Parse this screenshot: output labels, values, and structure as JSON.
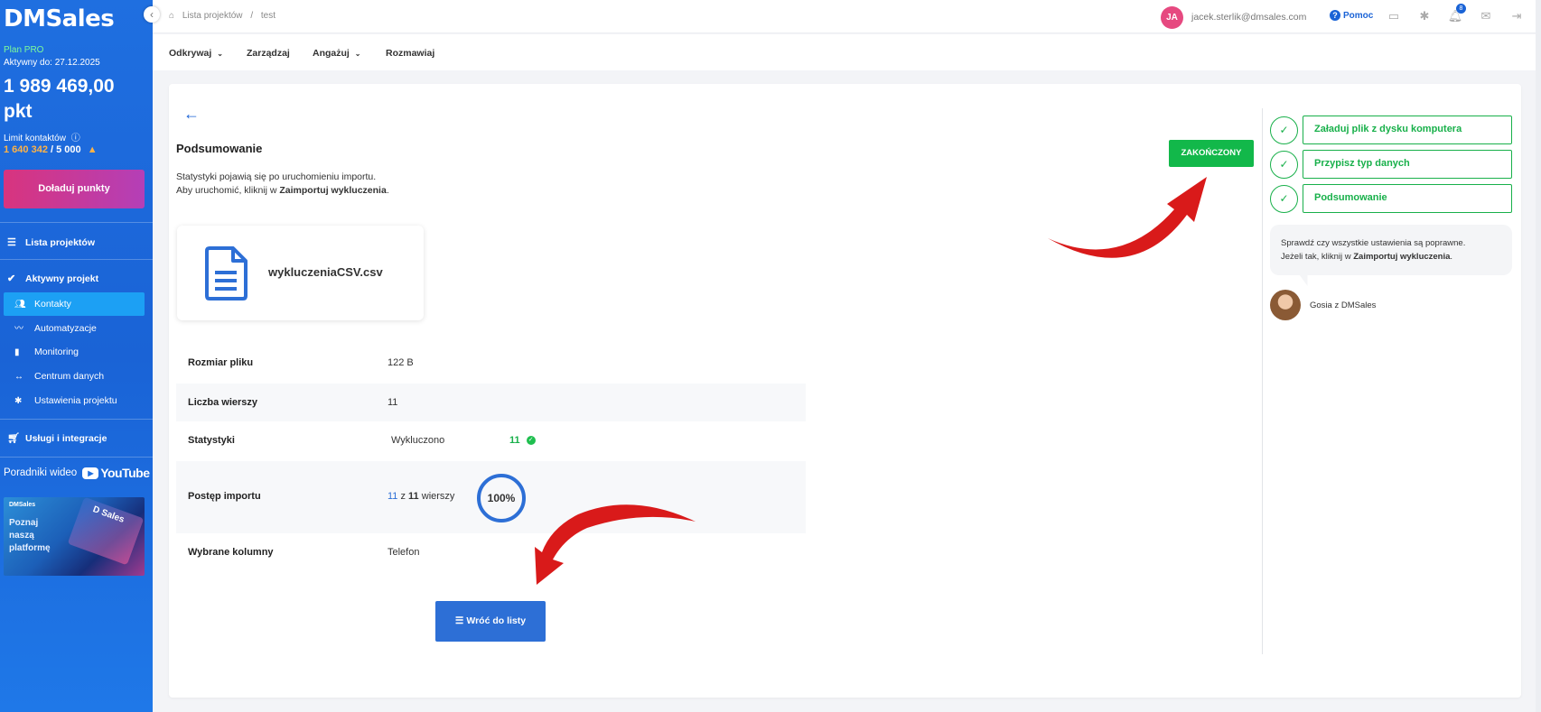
{
  "sidebar": {
    "logo": "DMSales",
    "plan": "Plan PRO",
    "active_until": "Aktywny do: 27.12.2025",
    "points": "1 989 469,00 pkt",
    "limit_label": "Limit kontaktów",
    "limit_used": "1 640 342",
    "limit_total": "/ 5 000",
    "topup_label": "Doładuj punkty",
    "nav": {
      "projects": "Lista projektów",
      "active_project": "Aktywny projekt",
      "contacts": "Kontakty",
      "automations": "Automatyzacje",
      "monitoring": "Monitoring",
      "data_center": "Centrum danych",
      "project_settings": "Ustawienia projektu",
      "services": "Usługi i integracje"
    },
    "video_guides": "Poradniki wideo",
    "youtube": "YouTube",
    "promo": {
      "brand": "DMSales",
      "line1": "Poznaj",
      "line2": "naszą",
      "line3": "platformę"
    }
  },
  "topbar": {
    "crumb_root": "Lista projektów",
    "crumb_sep": "/",
    "crumb_current": "test",
    "user_initials": "JA",
    "user_email": "jacek.sterlik@dmsales.com",
    "help": "Pomoc",
    "notifications_count": "8"
  },
  "menu": {
    "discover": "Odkrywaj",
    "manage": "Zarządzaj",
    "engage": "Angażuj",
    "talk": "Rozmawiaj"
  },
  "summary": {
    "title": "Podsumowanie",
    "desc_line1": "Statystyki pojawią się po uruchomieniu importu.",
    "desc_line2_pre": "Aby uruchomić, kliknij w ",
    "desc_line2_bold": "Zaimportuj wykluczenia",
    "desc_line2_post": ".",
    "file_name": "wykluczeniaCSV.csv",
    "status": "ZAKOŃCZONY",
    "rows": {
      "file_size_label": "Rozmiar pliku",
      "file_size_value": "122 B",
      "row_count_label": "Liczba wierszy",
      "row_count_value": "11",
      "stats_label": "Statystyki",
      "stats_excluded_label": "Wykluczono",
      "stats_excluded_value": "11",
      "progress_label": "Postęp importu",
      "progress_done": "11",
      "progress_of": "z",
      "progress_total": "11",
      "progress_unit": "wierszy",
      "progress_percent": "100%",
      "progress_fraction": 1.0,
      "columns_label": "Wybrane kolumny",
      "columns_value": "Telefon"
    },
    "back_button": "Wróć do listy"
  },
  "steps": [
    {
      "label": "Załaduj plik z dysku komputera"
    },
    {
      "label": "Przypisz typ danych"
    },
    {
      "label": "Podsumowanie"
    }
  ],
  "assistant": {
    "line1": "Sprawdź czy wszystkie ustawienia są poprawne.",
    "line2_pre": "Jeżeli tak, kliknij w ",
    "line2_bold": "Zaimportuj wykluczenia",
    "line2_post": ".",
    "name": "Gosia z DMSales"
  },
  "colors": {
    "sidebar_blue": "#1f6fe0",
    "success_green": "#12b84a",
    "primary_blue": "#2d6fd6",
    "arrow_red": "#d91a1a"
  }
}
